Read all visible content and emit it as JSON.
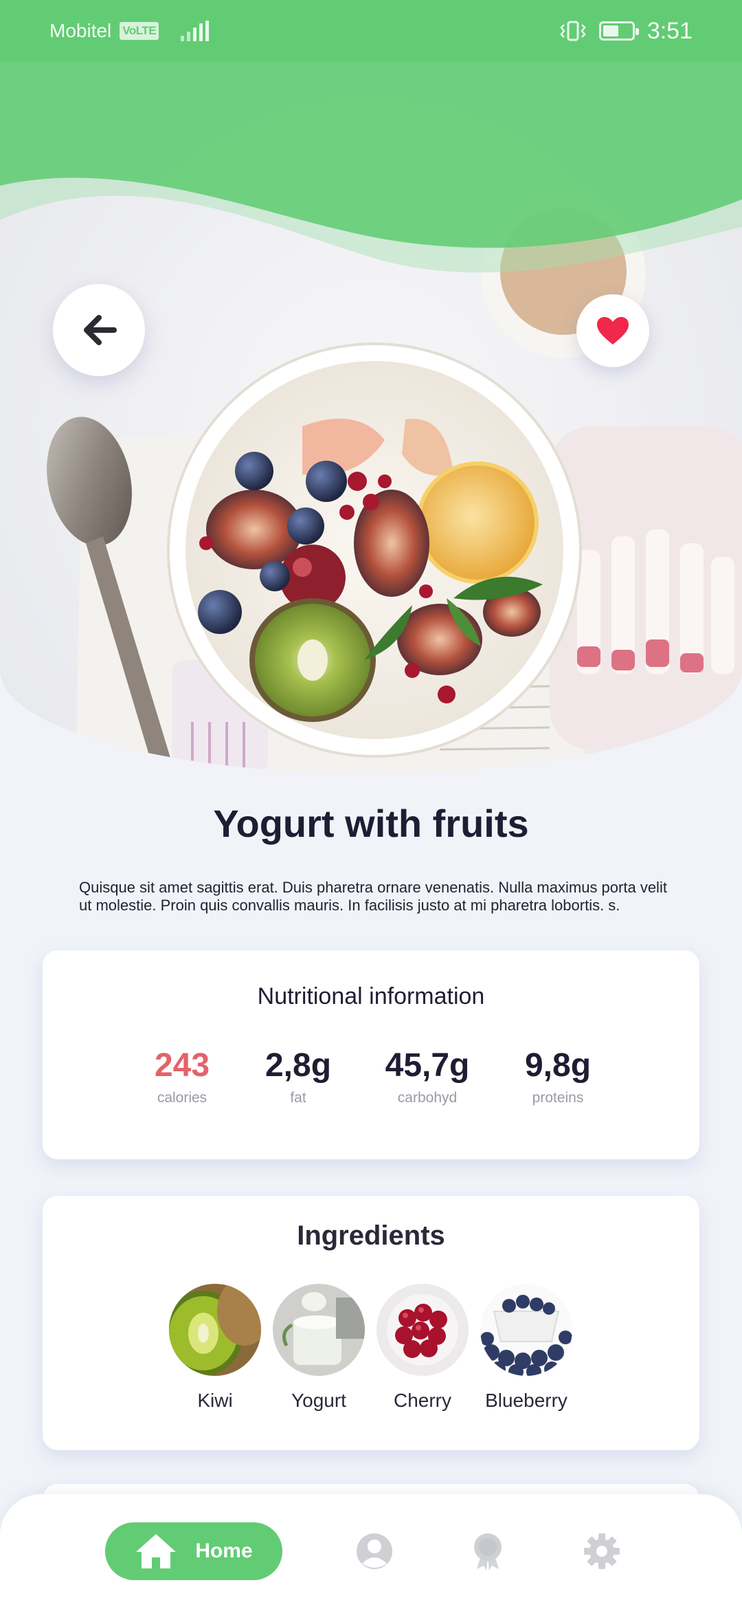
{
  "status_bar": {
    "carrier": "Mobitel",
    "network_badge": "VoLTE",
    "time": "3:51",
    "icons": [
      "signal-icon",
      "vibrate-icon",
      "battery-icon"
    ]
  },
  "header": {
    "back_icon": "back-arrow-icon",
    "favorite_icon": "heart-icon"
  },
  "recipe": {
    "title": "Yogurt with fruits",
    "description": "Quisque sit amet sagittis erat. Duis pharetra ornare venenatis. Nulla maximus porta velit ut molestie. Proin quis convallis mauris. In facilisis justo at mi pharetra lobortis. s."
  },
  "nutrition": {
    "title": "Nutritional information",
    "items": [
      {
        "value": "243",
        "label": "calories"
      },
      {
        "value": "2,8g",
        "label": "fat"
      },
      {
        "value": "45,7g",
        "label": "carbohyd"
      },
      {
        "value": "9,8g",
        "label": "proteins"
      }
    ]
  },
  "ingredients": {
    "title": "Ingredients",
    "items": [
      {
        "label": "Kiwi"
      },
      {
        "label": "Yogurt"
      },
      {
        "label": "Cherry"
      },
      {
        "label": "Blueberry"
      }
    ]
  },
  "bottom_nav": {
    "home_label": "Home",
    "icons": [
      "home-icon",
      "profile-icon",
      "award-icon",
      "settings-icon"
    ]
  },
  "colors": {
    "accent_green": "#62cc74",
    "calories_red": "#e3636a",
    "heart_red": "#f0284a",
    "text_dark": "#1f1d33",
    "background": "#f1f3f9"
  }
}
